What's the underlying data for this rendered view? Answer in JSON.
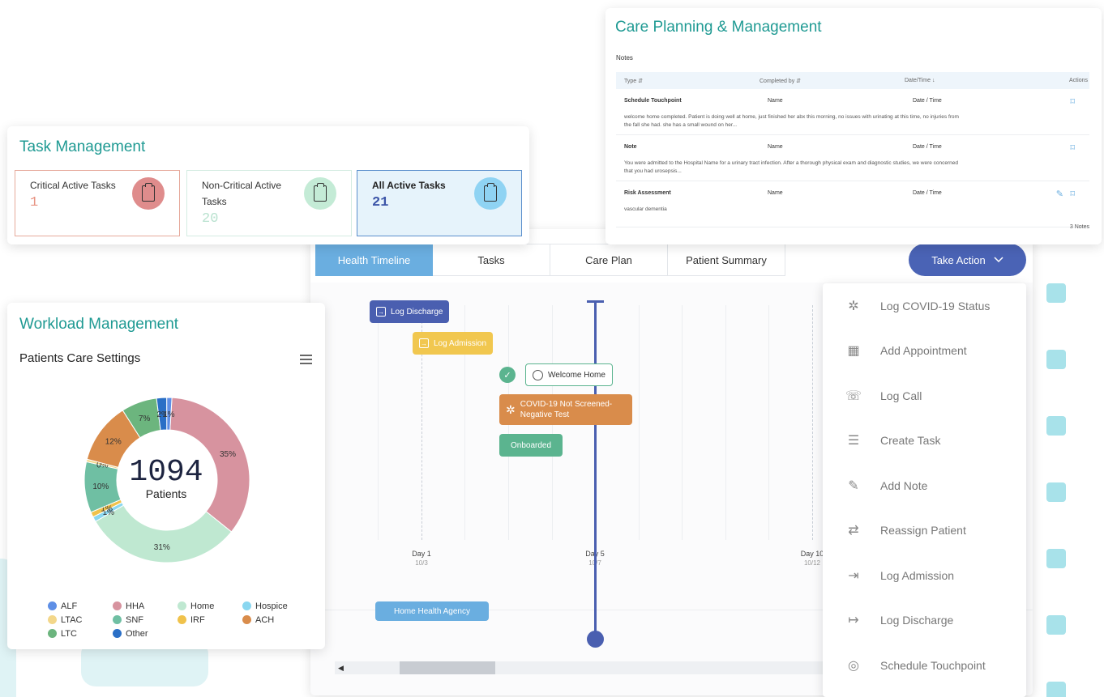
{
  "task_management": {
    "title": "Task Management",
    "boxes": [
      {
        "label": "Critical Active Tasks",
        "value": "1",
        "icon": "clipboard-clock-icon"
      },
      {
        "label": "Non-Critical Active Tasks",
        "value": "20",
        "icon": "clipboard-check-icon"
      },
      {
        "label": "All Active Tasks",
        "value": "21",
        "icon": "clipboard-list-icon"
      }
    ]
  },
  "care_planning": {
    "title": "Care Planning & Management",
    "notes_label": "Notes",
    "columns": [
      "Type",
      "Completed by",
      "Date/Time",
      "Actions"
    ],
    "rows": [
      {
        "type": "Schedule Touchpoint",
        "by": "Name",
        "date": "Date / Time",
        "text": "welcome home completed. Patient is doing well at home, just finished her abx this morning, no issues with urinating at this time, no injuries from the fall she had. she has a small wound on her..."
      },
      {
        "type": "Note",
        "by": "Name",
        "date": "Date / Time",
        "text": "You were admitted to the Hospital Name for a urinary tract infection. After a thorough physical exam and diagnostic studies, we were concerned that you had urosepsis..."
      },
      {
        "type": "Risk Assessment",
        "by": "Name",
        "date": "Date / Time",
        "text": "vascular dementia"
      }
    ],
    "count": "3 Notes"
  },
  "timeline": {
    "tabs": [
      "Health Timeline",
      "Tasks",
      "Care Plan",
      "Patient Summary"
    ],
    "take_action": "Take Action",
    "events": {
      "log_discharge": "Log Discharge",
      "log_admission": "Log Admission",
      "welcome_home": "Welcome Home",
      "covid": "COVID-19 Not Screened-Negative Test",
      "onboarded": "Onboarded",
      "agency": "Home Health Agency"
    },
    "days": [
      {
        "label": "Day 1",
        "date": "10/3"
      },
      {
        "label": "Day 5",
        "date": "10/7"
      },
      {
        "label": "Day 10",
        "date": "10/12"
      }
    ]
  },
  "menu": {
    "items": [
      {
        "label": "Log COVID-19 Status",
        "icon": "virus-icon"
      },
      {
        "label": "Add Appointment",
        "icon": "calendar-add-icon"
      },
      {
        "label": "Log Call",
        "icon": "phone-icon"
      },
      {
        "label": "Create Task",
        "icon": "checklist-icon"
      },
      {
        "label": "Add Note",
        "icon": "pen-icon"
      },
      {
        "label": "Reassign Patient",
        "icon": "swap-icon"
      },
      {
        "label": "Log Admission",
        "icon": "login-icon"
      },
      {
        "label": "Log Discharge",
        "icon": "logout-icon"
      },
      {
        "label": "Schedule Touchpoint",
        "icon": "person-circle-icon"
      }
    ]
  },
  "workload": {
    "title": "Workload Management",
    "subtitle": "Patients Care Settings",
    "center_value": "1094",
    "center_label": "Patients"
  },
  "chart_data": {
    "type": "pie",
    "title": "Patients Care Settings",
    "total": "1094",
    "series": [
      {
        "name": "HHA",
        "value": 35,
        "label": "35%",
        "color": "#d7939f"
      },
      {
        "name": "Home",
        "value": 31,
        "label": "31%",
        "color": "#bfe8d1"
      },
      {
        "name": "Hospice",
        "value": 1,
        "label": "1%",
        "color": "#8ad7f0"
      },
      {
        "name": "IRF",
        "value": 1,
        "label": "1%",
        "color": "#f0c24b"
      },
      {
        "name": "SNF",
        "value": 10,
        "label": "10%",
        "color": "#6fbfa3"
      },
      {
        "name": "LTAC",
        "value": 0.5,
        "label": "0%",
        "color": "#f3d78a"
      },
      {
        "name": "ACH",
        "value": 12,
        "label": "12%",
        "color": "#d98c4b"
      },
      {
        "name": "LTC",
        "value": 7,
        "label": "7%",
        "color": "#6cb57e"
      },
      {
        "name": "Other",
        "value": 2,
        "label": "2%",
        "color": "#2a6fc6"
      },
      {
        "name": "ALF",
        "value": 1,
        "label": "1%",
        "color": "#5e8fe6"
      }
    ],
    "legend": [
      "ALF",
      "HHA",
      "Home",
      "Hospice",
      "LTAC",
      "SNF",
      "IRF",
      "ACH",
      "LTC",
      "Other"
    ]
  },
  "colors": {
    "teal": "#1f9a93",
    "navy": "#4a5fb0",
    "blue_tab": "#6aaee0"
  }
}
